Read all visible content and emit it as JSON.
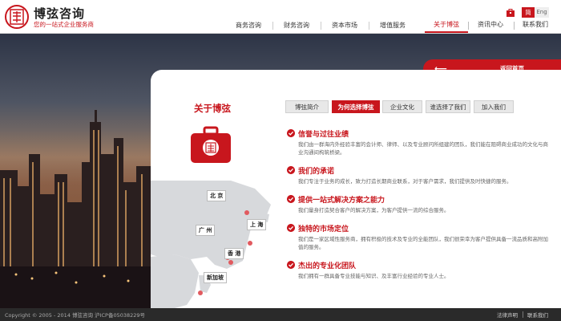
{
  "brand": {
    "name": "博弦咨询",
    "slogan": "您的一站式企业服务商"
  },
  "main_nav": [
    {
      "label": "商务咨询"
    },
    {
      "label": "财务咨询"
    },
    {
      "label": "资本市场"
    },
    {
      "label": "增值服务"
    }
  ],
  "top_nav": [
    {
      "label": "关于博弦",
      "active": true
    },
    {
      "label": "资讯中心"
    },
    {
      "label": "联系我们"
    }
  ],
  "lang": {
    "zh": "简",
    "en": "Eng"
  },
  "icons": {
    "cart": "cart-icon",
    "back": "arrow-left-icon",
    "check": "check-icon",
    "briefcase": "briefcase-icon",
    "map": "map-icon"
  },
  "back_banner": {
    "arrow": "⟵",
    "label": "返回首页"
  },
  "about": {
    "title": "关于博弦"
  },
  "tabs": [
    {
      "label": "博弦简介"
    },
    {
      "label": "为何选择博弦",
      "active": true
    },
    {
      "label": "企业文化"
    },
    {
      "label": "谁选择了我们"
    },
    {
      "label": "加入我们"
    }
  ],
  "features": [
    {
      "title": "信誉与过往业绩",
      "desc": "我们由一群海内外经验丰富的会计师、律师、以及专业顾问所组建的团队，我们能在阻碍商业成功的文化与商业沟通间构筑桥梁。"
    },
    {
      "title": "我们的承诺",
      "desc": "我们专注于业务的成长，致力打造长期商业联系，对于客户需求，我们提供及时快捷的服务。"
    },
    {
      "title": "提供一站式解决方案之能力",
      "desc": "我们量身打造契合客户的解决方案，为客户提供一流的综合服务。"
    },
    {
      "title": "独特的市场定位",
      "desc": "我们是一家区域性服务商，拥有积极的技术及专业的全能团队，我们很荣幸为客户提供具备一流品质和高附加值的服务。"
    },
    {
      "title": "杰出的专业化团队",
      "desc": "我们拥有一群具备专业技能与知识、及丰富行业经验的专业人士。"
    }
  ],
  "map": {
    "cities": [
      {
        "name": "北 京"
      },
      {
        "name": "上 海"
      },
      {
        "name": "广 州"
      },
      {
        "name": "香 港"
      },
      {
        "name": "新加坡"
      }
    ]
  },
  "footer": {
    "copyright": "Copyright © 2005 - 2014 博弦咨询 沪ICP备05038229号",
    "links": [
      {
        "label": "法律声明"
      },
      {
        "label": "联系我们"
      }
    ]
  },
  "colors": {
    "accent": "#c8161d",
    "footer_bg": "#2a2a2a",
    "panel_bg": "#ffffff"
  }
}
